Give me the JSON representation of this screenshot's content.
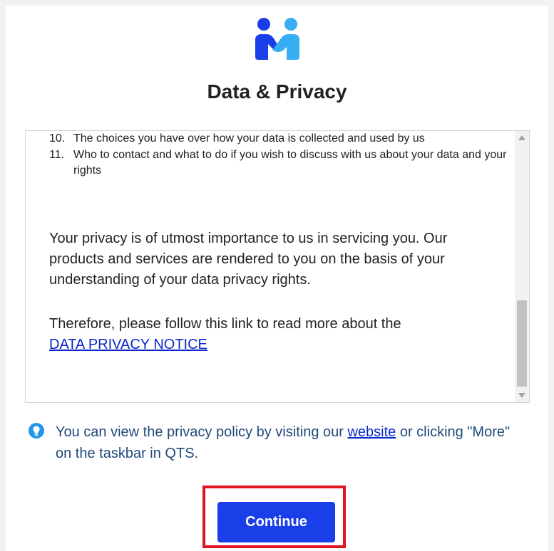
{
  "dialog": {
    "title": "Data & Privacy",
    "logo_icon": "handshake-people-logo"
  },
  "policy": {
    "list_items": [
      {
        "number": "10.",
        "text": "The choices you have over how your data is collected and used by us"
      },
      {
        "number": "11.",
        "text": "Who to contact and what to do if you wish to discuss with us about your data and your rights"
      }
    ],
    "paragraph1": "Your privacy is of utmost importance to us in servicing you. Our products and services are rendered to you on the basis of your understanding of your data privacy rights.",
    "paragraph2": "Therefore, please follow this link to read more about the",
    "link_label": "DATA PRIVACY NOTICE"
  },
  "note": {
    "icon": "lightbulb-info-icon",
    "text_before": "You can view the privacy policy by visiting our ",
    "link_label": "website",
    "text_after": " or clicking \"More\" on the taskbar in QTS."
  },
  "actions": {
    "continue_label": "Continue"
  },
  "colors": {
    "accent": "#1a3ee8",
    "link": "#0a27c8",
    "highlight_border": "#e0141e",
    "note_text": "#1f4a7a"
  }
}
